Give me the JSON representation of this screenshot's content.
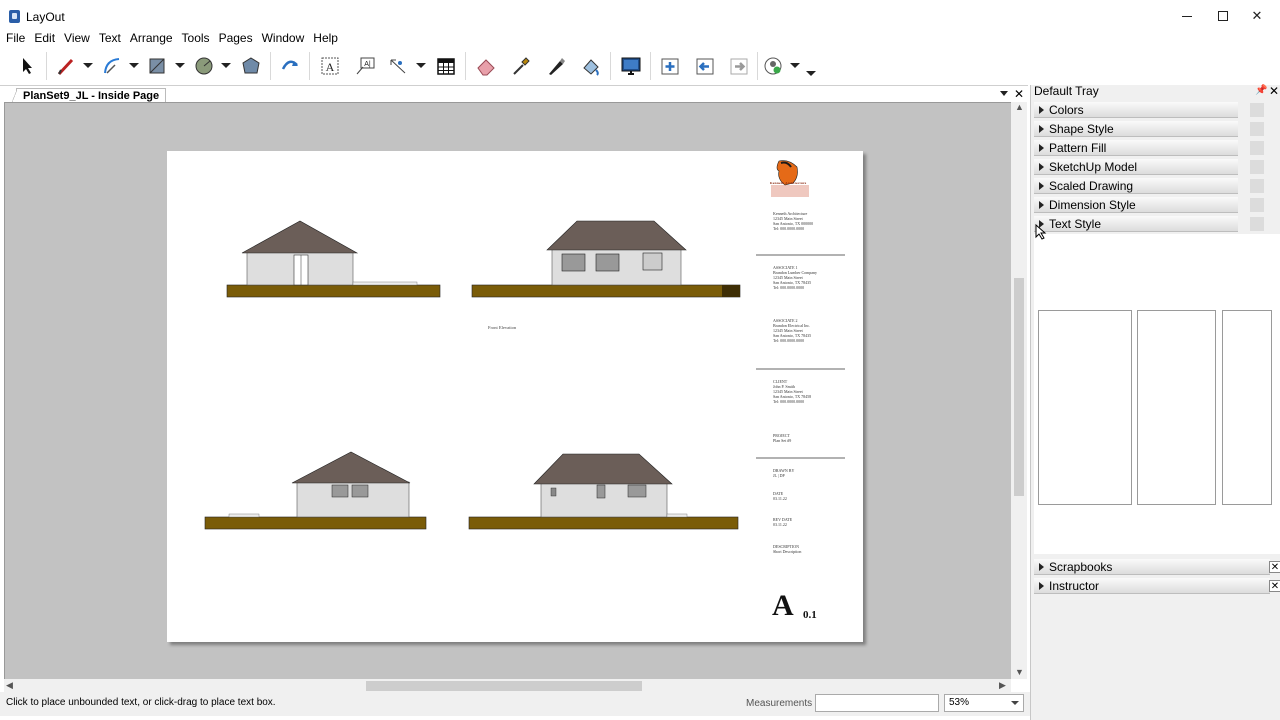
{
  "app": {
    "title": "LayOut"
  },
  "menu": [
    "File",
    "Edit",
    "View",
    "Text",
    "Arrange",
    "Tools",
    "Pages",
    "Window",
    "Help"
  ],
  "toolbar": {
    "tools": [
      "select-tool",
      "line-tool",
      "arc-tool",
      "rectangle-tool",
      "circle-tool",
      "polygon-tool",
      "split-tool",
      "text-tool",
      "label-tool",
      "dimension-tool",
      "table-tool",
      "eraser-tool",
      "style-tool",
      "pen-tool",
      "sample-tool",
      "presentation-tool",
      "add-page-tool",
      "previous-page-tool",
      "next-page-tool",
      "instructor-tool"
    ]
  },
  "document": {
    "tab_label": "PlanSet9_JL - Inside Page",
    "elevation_label": "Front Elevation",
    "title_block": {
      "company": [
        "Kenneth Architecture",
        "12345 Main Street",
        "San Antonio, TX 000000",
        "Tel: 000.0000.0000"
      ],
      "associate1_head": "ASSOCIATE 1",
      "associate1": [
        "Brandon Lumber Company",
        "12345 Main Street",
        "San Antonio, TX 78435",
        "Tel: 000.0000.0000"
      ],
      "associate2_head": "ASSOCIATE 2",
      "associate2": [
        "Brandon Electrical Inc.",
        "12345 Main Street",
        "San Antonio, TX 78435",
        "Tel: 000.0000.0000"
      ],
      "client_head": "CLIENT",
      "client": [
        "John P. Smith",
        "12345 Main Street",
        "San Antonio, TX 78458",
        "Tel: 000.0000.0000"
      ],
      "project_head": "PROJECT",
      "project": "Plan Set #9",
      "drawn_head": "DRAWN BY",
      "drawn": "JL | DP",
      "date_head": "DATE",
      "date": "03.11.22",
      "rev_head": "REV DATE",
      "rev": "03.11.22",
      "desc_head": "DESCRIPTION",
      "desc": "Short Description",
      "sheet_letter": "A",
      "sheet_number": "0.1"
    }
  },
  "status": {
    "hint": "Click to place unbounded text, or click-drag to place text box.",
    "measurements_label": "Measurements",
    "measurements_value": "",
    "zoom": "53%"
  },
  "tray": {
    "title": "Default Tray",
    "panels": [
      "Colors",
      "Shape Style",
      "Pattern Fill",
      "SketchUp Model",
      "Scaled Drawing",
      "Dimension Style",
      "Text Style"
    ],
    "bottom_panels": [
      "Scrapbooks",
      "Instructor"
    ]
  },
  "colors": {
    "roof": "#6b5e58",
    "wall": "#dedede",
    "ground": "#7a5c08",
    "ground_dark": "#3e2e05",
    "accent": "#2a5ea8"
  }
}
